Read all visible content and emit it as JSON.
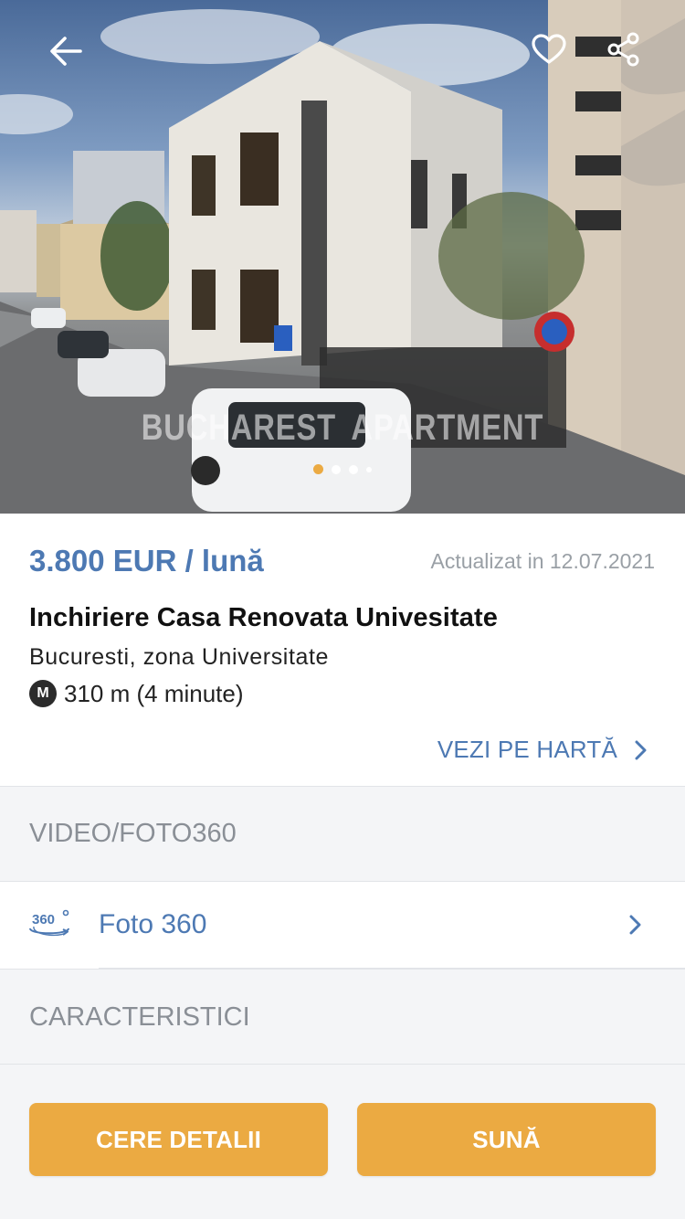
{
  "hero": {
    "watermark_left": "BUCHAREST",
    "watermark_right": "APARTMENT",
    "dots": [
      {
        "state": "active"
      },
      {
        "state": "normal"
      },
      {
        "state": "normal"
      },
      {
        "state": "small"
      }
    ],
    "active_dot_color": "#ebaa42"
  },
  "listing": {
    "price": "3.800 EUR / lună",
    "updated": "Actualizat in 12.07.2021",
    "title": "Inchiriere Casa Renovata Univesitate",
    "location": "Bucuresti, zona Universitate",
    "metro_badge": "M",
    "metro_distance": "310 m (4 minute)",
    "map_link": "VEZI PE HARTĂ"
  },
  "sections": {
    "media_heading": "VIDEO/FOTO360",
    "media_items": [
      {
        "label": "Foto 360",
        "icon": "360-view-icon"
      }
    ],
    "features_heading": "CARACTERISTICI"
  },
  "actions": {
    "details_label": "CERE DETALII",
    "call_label": "SUNĂ"
  },
  "colors": {
    "accent_blue": "#4d79b3",
    "button_orange": "#ebaa42",
    "muted_text": "#9aa0a6"
  }
}
